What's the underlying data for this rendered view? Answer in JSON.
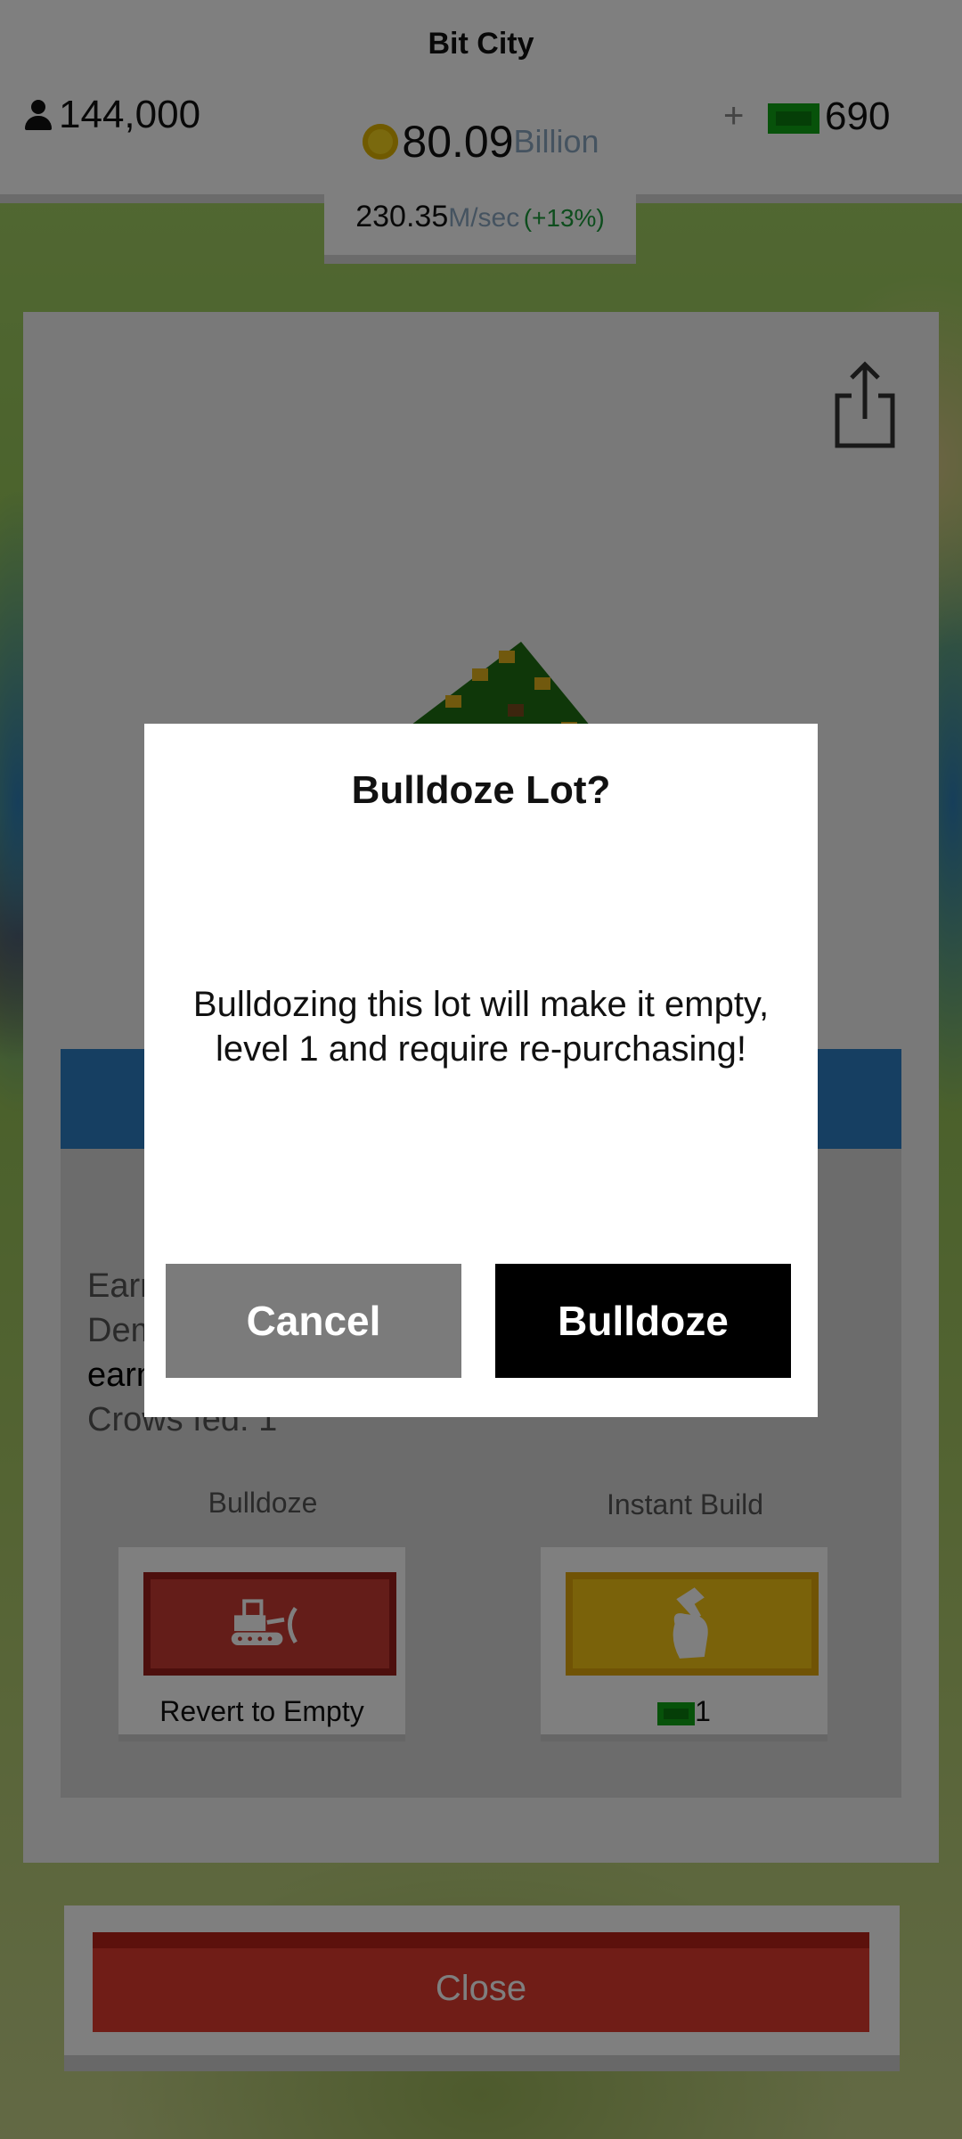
{
  "header": {
    "title": "Bit City",
    "population": "144,000",
    "money_value": "80.09",
    "money_unit": "Billion",
    "plus": "+",
    "cash_value": "690"
  },
  "rate": {
    "value": "230.35",
    "unit": "M/sec",
    "percent": "(+13%)"
  },
  "panel": {
    "info_lines": [
      "Earn",
      "Dem",
      "earn",
      "Crows fed: 1"
    ],
    "bulldoze_label": "Bulldoze",
    "bulldoze_caption": "Revert to Empty",
    "instant_label": "Instant Build",
    "instant_cost": "1",
    "close_label": "Close"
  },
  "modal": {
    "title": "Bulldoze Lot?",
    "message": "Bulldozing this lot will make it empty, level 1 and require re-purchasing!",
    "cancel_label": "Cancel",
    "confirm_label": "Bulldoze"
  },
  "colors": {
    "accent_blue": "#2d7fc4",
    "cash_green": "#0fa514",
    "close_red": "#e03a2f",
    "bulldoze_red": "#c93a33",
    "instant_yellow": "#f4c514"
  },
  "icons": [
    "person-icon",
    "coin-icon",
    "cash-icon",
    "share-icon",
    "bulldozer-icon",
    "hammer-hand-icon"
  ]
}
